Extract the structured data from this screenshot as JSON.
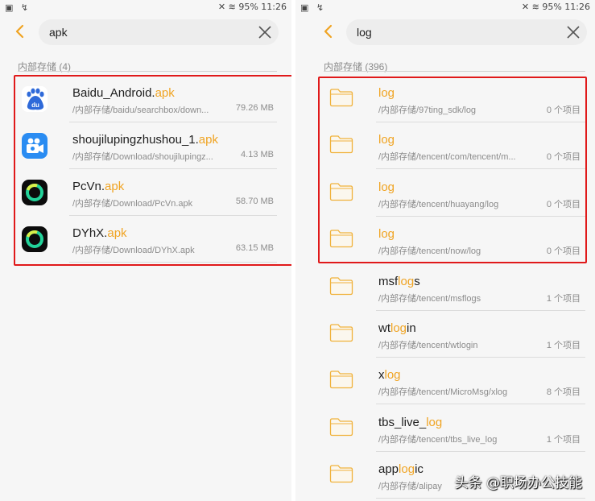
{
  "left_panel": {
    "status": {
      "icons": "▣ ↯",
      "right": "✕ ≋ 95% 11:26"
    },
    "search": {
      "query": "apk"
    },
    "section": {
      "header": "内部存储 (4)"
    },
    "items": [
      {
        "name_prefix": "Baidu_Android.",
        "name_highlight": "apk",
        "name_suffix": "",
        "path": "/内部存储/baidu/searchbox/down...",
        "meta": "79.26 MB",
        "icon": "baidu-app-icon"
      },
      {
        "name_prefix": "shoujilupingzhushou_1.",
        "name_highlight": "apk",
        "name_suffix": "",
        "path": "/内部存储/Download/shoujilupingz...",
        "meta": "4.13 MB",
        "icon": "screen-recorder-app-icon"
      },
      {
        "name_prefix": "PcVn.",
        "name_highlight": "apk",
        "name_suffix": "",
        "path": "/内部存储/Download/PcVn.apk",
        "meta": "58.70 MB",
        "icon": "ring-app-icon"
      },
      {
        "name_prefix": "DYhX.",
        "name_highlight": "apk",
        "name_suffix": "",
        "path": "/内部存储/Download/DYhX.apk",
        "meta": "63.15 MB",
        "icon": "ring-app-icon"
      }
    ]
  },
  "right_panel": {
    "status": {
      "icons": "▣ ↯",
      "right": "✕ ≋ 95% 11:26"
    },
    "search": {
      "query": "log"
    },
    "section": {
      "header": "内部存储 (396)"
    },
    "items": [
      {
        "name_prefix": "",
        "name_highlight": "log",
        "name_suffix": "",
        "path": "/内部存储/97ting_sdk/log",
        "meta": "0 个项目"
      },
      {
        "name_prefix": "",
        "name_highlight": "log",
        "name_suffix": "",
        "path": "/内部存储/tencent/com/tencent/m...",
        "meta": "0 个项目"
      },
      {
        "name_prefix": "",
        "name_highlight": "log",
        "name_suffix": "",
        "path": "/内部存储/tencent/huayang/log",
        "meta": "0 个项目"
      },
      {
        "name_prefix": "",
        "name_highlight": "log",
        "name_suffix": "",
        "path": "/内部存储/tencent/now/log",
        "meta": "0 个项目"
      },
      {
        "name_prefix": "msf",
        "name_highlight": "log",
        "name_suffix": "s",
        "path": "/内部存储/tencent/msflogs",
        "meta": "1 个项目"
      },
      {
        "name_prefix": "wt",
        "name_highlight": "log",
        "name_suffix": "in",
        "path": "/内部存储/tencent/wtlogin",
        "meta": "1 个项目"
      },
      {
        "name_prefix": "x",
        "name_highlight": "log",
        "name_suffix": "",
        "path": "/内部存储/tencent/MicroMsg/xlog",
        "meta": "8 个项目"
      },
      {
        "name_prefix": "tbs_live_",
        "name_highlight": "log",
        "name_suffix": "",
        "path": "/内部存储/tencent/tbs_live_log",
        "meta": "1 个项目"
      },
      {
        "name_prefix": "app",
        "name_highlight": "log",
        "name_suffix": "ic",
        "path": "/内部存储/alipay",
        "meta": ""
      }
    ]
  },
  "watermark": {
    "text": "头条 @职场办公技能"
  },
  "colors": {
    "accent": "#f0a423",
    "highlight_box": "#e0191a",
    "background": "#f6f6f6"
  }
}
